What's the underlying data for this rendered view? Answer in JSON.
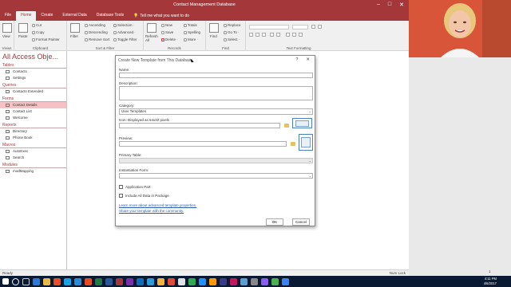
{
  "titlebar": {
    "title": "Contact Management Database",
    "min": "–",
    "max": "□",
    "close": "✕"
  },
  "menu": {
    "tabs": [
      "File",
      "Home",
      "Create",
      "External Data",
      "Database Tools"
    ],
    "active": "Home",
    "tellme": "Tell me what you want to do"
  },
  "ribbon": {
    "views": {
      "label": "View",
      "group": "Views"
    },
    "clipboard": {
      "paste": "Paste",
      "cut": "Cut",
      "copy": "Copy",
      "format_painter": "Format Painter",
      "group": "Clipboard"
    },
    "sort": {
      "filter": "Filter",
      "ascending": "Ascending",
      "descending": "Descending",
      "remove_sort": "Remove Sort",
      "selection": "Selection ·",
      "advanced": "Advanced ·",
      "toggle_filter": "Toggle Filter",
      "group": "Sort & Filter"
    },
    "records": {
      "refresh": "Refresh All",
      "new": "New",
      "save": "Save",
      "delete": "Delete ·",
      "totals": "Totals",
      "spelling": "Spelling",
      "more": "More ·",
      "group": "Records"
    },
    "find": {
      "find": "Find",
      "replace": "Replace",
      "goto": "Go To ·",
      "select": "Select ·",
      "group": "Find"
    },
    "text": {
      "group": "Text Formatting"
    }
  },
  "nav": {
    "header": "All Access Obje...",
    "sections": [
      {
        "title": "Tables",
        "items": [
          "Contacts",
          "Settings"
        ]
      },
      {
        "title": "Queries",
        "items": [
          "Contacts Extended"
        ]
      },
      {
        "title": "Forms",
        "items": [
          "Contact Details",
          "Contact List",
          "Welcome"
        ]
      },
      {
        "title": "Reports",
        "items": [
          "Directory",
          "Phone Book"
        ]
      },
      {
        "title": "Macros",
        "items": [
          "AutoExec",
          "Search"
        ]
      },
      {
        "title": "Modules",
        "items": [
          "modMapping"
        ]
      }
    ],
    "selected": "Contact Details"
  },
  "statusbar": {
    "left": "Ready",
    "right": "Num Lock"
  },
  "dialog": {
    "title": "Create New Template from This Database",
    "help": "?",
    "close": "✕",
    "name_label": "Name:",
    "description_label": "Description:",
    "category_label": "Category:",
    "category_value": "User Templates",
    "icon_label": "Icon: Displayed as 64x32 pixels",
    "preview_label": "Preview:",
    "primary_table_label": "Primary Table:",
    "instantiation_label": "Instantiation Form:",
    "application_part": "Application Part",
    "include_data": "Include All Data in Package",
    "link_advanced": "Learn more about advanced template properties.",
    "link_share": "Share your template with the community.",
    "ok": "OK",
    "cancel": "Cancel"
  },
  "taskbar": {
    "time": "4:11 PM",
    "date": "4/6/2017"
  },
  "desktop": {
    "number": "1"
  },
  "colors": {
    "accent": "#a4373a",
    "selected": "#f6c1c2",
    "link": "#2a5db0",
    "taskbar": "#0a1a33"
  }
}
